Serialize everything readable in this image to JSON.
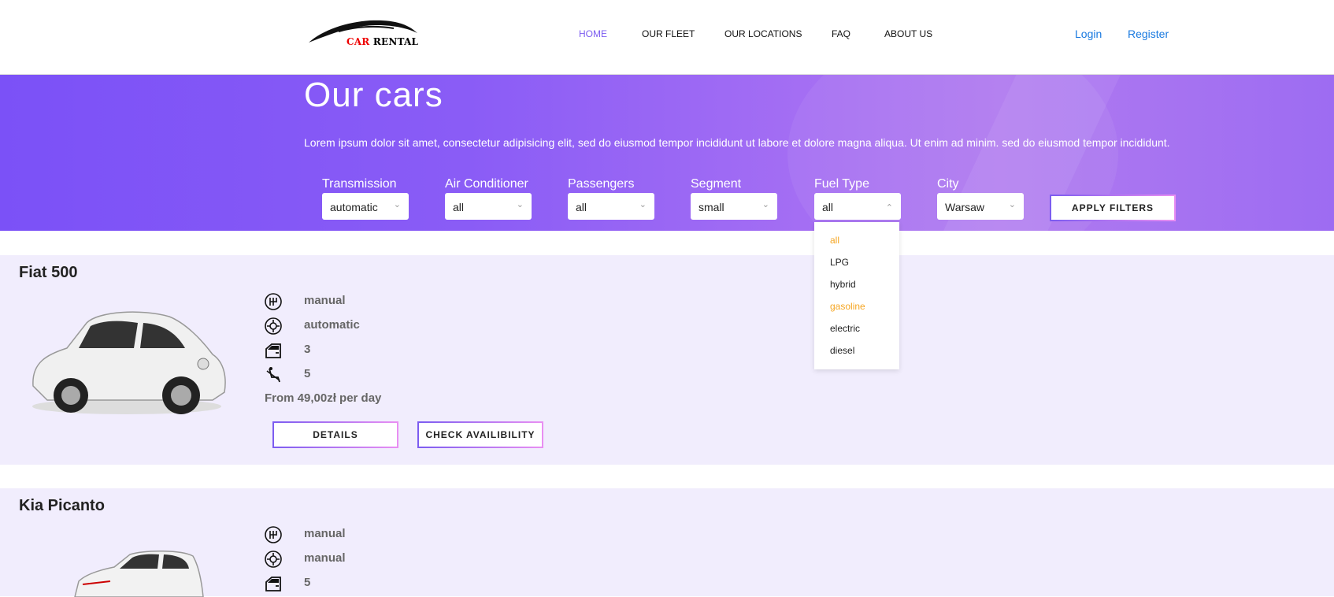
{
  "header": {
    "logo": {
      "word1": "CAR",
      "word2": "RENTAL"
    },
    "nav": [
      "HOME",
      "OUR FLEET",
      "OUR LOCATIONS",
      "FAQ",
      "ABOUT US"
    ],
    "login": "Login",
    "register": "Register"
  },
  "hero": {
    "title": "Our cars",
    "subtitle": "Lorem ipsum dolor sit amet, consectetur adipisicing elit, sed do eiusmod tempor incididunt ut labore et dolore magna aliqua. Ut enim ad minim. sed do eiusmod tempor incididunt."
  },
  "filters": [
    {
      "label": "Transmission",
      "value": "automatic"
    },
    {
      "label": "Air Conditioner",
      "value": "all"
    },
    {
      "label": "Passengers",
      "value": "all"
    },
    {
      "label": "Segment",
      "value": "small"
    },
    {
      "label": "Fuel Type",
      "value": "all"
    },
    {
      "label": "City",
      "value": "Warsaw"
    }
  ],
  "apply_label": "APPLY FILTERS",
  "fuel_options": [
    "all",
    "LPG",
    "hybrid",
    "gasoline",
    "electric",
    "diesel"
  ],
  "colors": {
    "accent": "#7c5cf0",
    "highlight": "#f5a623",
    "link": "#1a7ae0"
  },
  "cars": [
    {
      "name": "Fiat 500",
      "specs": [
        "manual",
        "automatic",
        "3",
        "5"
      ],
      "price": "From 49,00zł per day",
      "details_label": "DETAILS",
      "check_label": "CHECK AVAILIBILITY"
    },
    {
      "name": "Kia Picanto",
      "specs": [
        "manual",
        "manual",
        "5"
      ]
    }
  ]
}
